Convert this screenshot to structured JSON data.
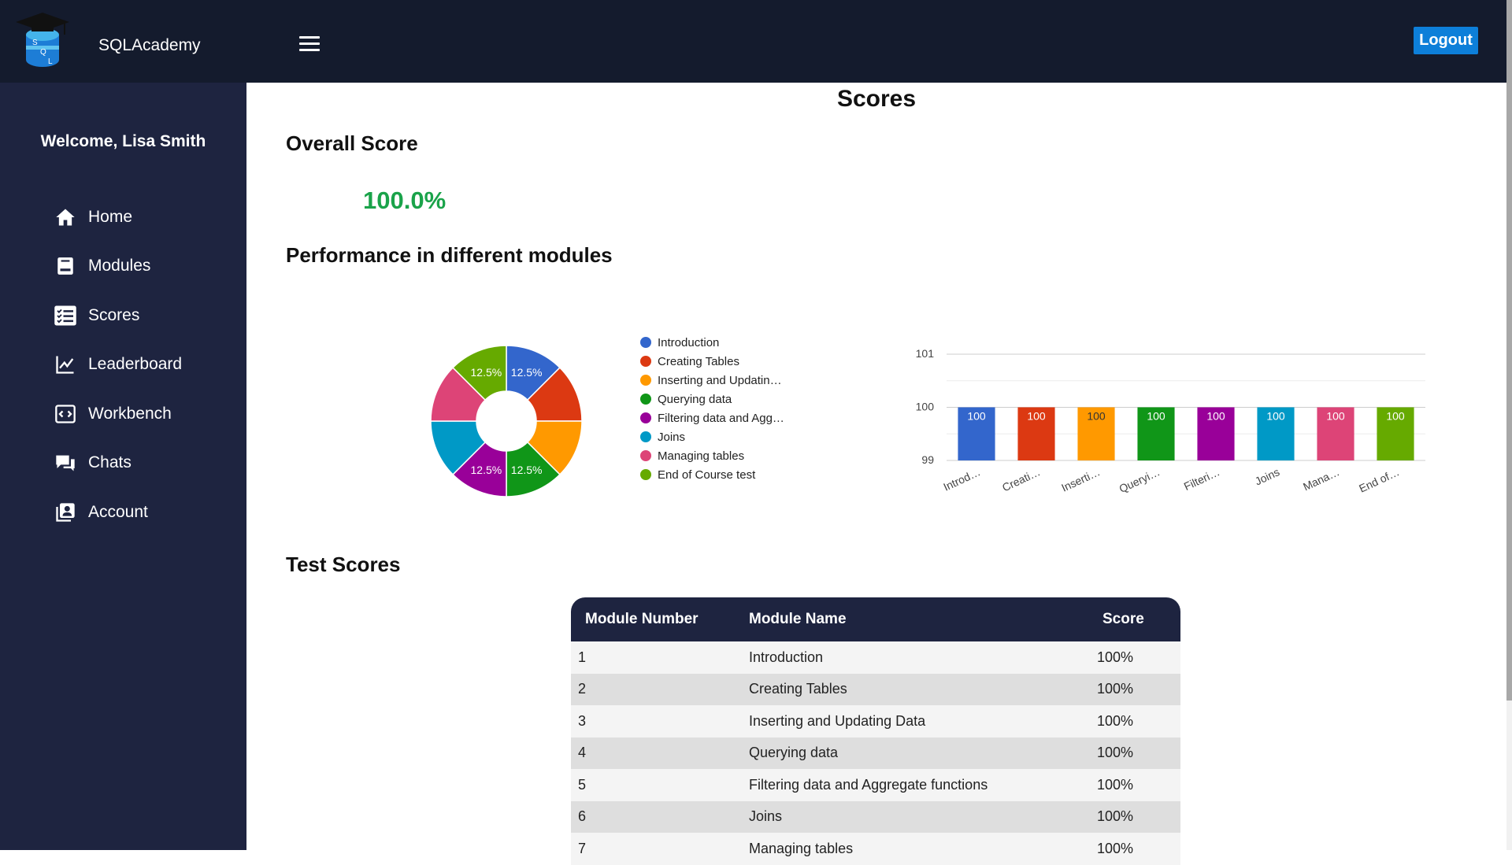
{
  "header": {
    "brand": "SQLAcademy",
    "logo_letters": [
      "S",
      "Q",
      "L"
    ],
    "logout_label": "Logout"
  },
  "sidebar": {
    "welcome": "Welcome, Lisa Smith",
    "items": [
      {
        "label": "Home",
        "icon": "home-icon"
      },
      {
        "label": "Modules",
        "icon": "book-icon"
      },
      {
        "label": "Scores",
        "icon": "checklist-icon"
      },
      {
        "label": "Leaderboard",
        "icon": "line-chart-icon"
      },
      {
        "label": "Workbench",
        "icon": "code-icon"
      },
      {
        "label": "Chats",
        "icon": "chat-icon"
      },
      {
        "label": "Account",
        "icon": "account-icon"
      }
    ]
  },
  "main": {
    "title": "Scores",
    "overall_title": "Overall Score",
    "overall_value": "100.0%",
    "performance_title": "Performance in different modules",
    "tests_title": "Test Scores"
  },
  "chart_data": [
    {
      "type": "pie",
      "donut": true,
      "categories": [
        "Introduction",
        "Creating Tables",
        "Inserting and Updatin…",
        "Querying data",
        "Filtering data and Agg…",
        "Joins",
        "Managing tables",
        "End of Course test"
      ],
      "values": [
        12.5,
        12.5,
        12.5,
        12.5,
        12.5,
        12.5,
        12.5,
        12.5
      ],
      "colors": [
        "#3366cc",
        "#dc3912",
        "#ff9900",
        "#109618",
        "#990099",
        "#0099c6",
        "#dd4477",
        "#66aa00"
      ],
      "shown_labels": [
        "12.5%",
        "12.5%",
        "12.5%",
        "12.5%"
      ],
      "legend_position": "right"
    },
    {
      "type": "bar",
      "categories": [
        "Introd…",
        "Creati…",
        "Inserti…",
        "Queryi…",
        "Filteri…",
        "Joins",
        "Mana…",
        "End of…"
      ],
      "values": [
        100,
        100,
        100,
        100,
        100,
        100,
        100,
        100
      ],
      "data_labels": [
        "100",
        "100",
        "100",
        "100",
        "100",
        "100",
        "100",
        "100"
      ],
      "colors": [
        "#3366cc",
        "#dc3912",
        "#ff9900",
        "#109618",
        "#990099",
        "#0099c6",
        "#dd4477",
        "#66aa00"
      ],
      "yticks": [
        "99",
        "100",
        "101"
      ],
      "ylim": [
        99,
        101
      ]
    }
  ],
  "table": {
    "headers": [
      "Module Number",
      "Module Name",
      "Score"
    ],
    "rows": [
      [
        "1",
        "Introduction",
        "100%"
      ],
      [
        "2",
        "Creating Tables",
        "100%"
      ],
      [
        "3",
        "Inserting and Updating Data",
        "100%"
      ],
      [
        "4",
        "Querying data",
        "100%"
      ],
      [
        "5",
        "Filtering data and Aggregate functions",
        "100%"
      ],
      [
        "6",
        "Joins",
        "100%"
      ],
      [
        "7",
        "Managing tables",
        "100%"
      ]
    ]
  }
}
